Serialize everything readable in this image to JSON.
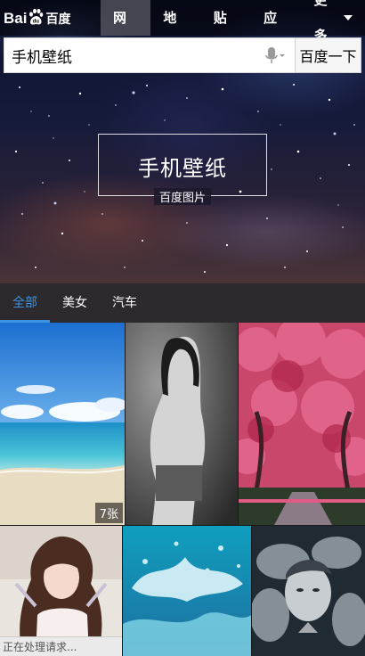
{
  "header": {
    "logo": {
      "latin_left": "Bai",
      "latin_right": "",
      "chinese": "百度"
    },
    "nav": [
      {
        "label": "网页",
        "active": true
      },
      {
        "label": "地图",
        "active": false
      },
      {
        "label": "贴吧",
        "active": false
      },
      {
        "label": "应用",
        "active": false
      },
      {
        "label": "更多",
        "active": false,
        "dropdown": true
      }
    ]
  },
  "search": {
    "value": "手机壁纸",
    "button_label": "百度一下",
    "mic_icon": "microphone-icon"
  },
  "hero": {
    "title": "手机壁纸",
    "subtitle": "百度图片"
  },
  "tabs": [
    {
      "label": "全部",
      "active": true
    },
    {
      "label": "美女",
      "active": false
    },
    {
      "label": "汽车",
      "active": false
    }
  ],
  "images": [
    {
      "id": "beach",
      "badge": "7张"
    },
    {
      "id": "portrait-bw",
      "badge": ""
    },
    {
      "id": "pink-trees",
      "badge": ""
    },
    {
      "id": "girl-photo",
      "badge": ""
    },
    {
      "id": "water-splash",
      "badge": ""
    },
    {
      "id": "smoke-portrait",
      "badge": ""
    }
  ],
  "status": {
    "text": "正在处理请求..."
  },
  "colors": {
    "accent": "#3e93e0",
    "tab_bg": "#2c2a2d"
  }
}
